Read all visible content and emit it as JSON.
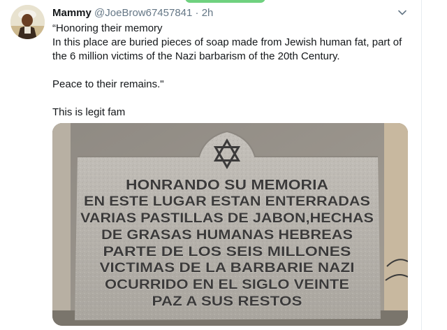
{
  "tweet": {
    "author_name": "Mammy",
    "handle": "@JoeBrow67457841",
    "separator": "·",
    "time": "2h",
    "lines": [
      "“Honoring their memory",
      "In this place are buried pieces of soap made from Jewish human fat, part of",
      "the 6 million victims of the Nazi barbarism of the 20th Century.",
      "Peace to their remains.\"",
      "This is legit fam"
    ]
  },
  "plaque": {
    "lines": [
      "HONRANDO SU MEMORIA",
      "EN ESTE LUGAR ESTAN ENTERRADAS",
      "VARIAS PASTILLAS DE JABON,HECHAS",
      "DE GRASAS HUMANAS HEBREAS",
      "PARTE DE LOS SEIS MILLONES",
      "VICTIMAS DE LA BARBARIE NAZI",
      "OCURRIDO EN EL SIGLO VEINTE",
      "PAZ A SUS RESTOS"
    ]
  },
  "colors": {
    "primary_text": "#14171a",
    "secondary_text": "#657786",
    "engraving": "#3b3a3a",
    "stone": "#b5b1ab"
  }
}
